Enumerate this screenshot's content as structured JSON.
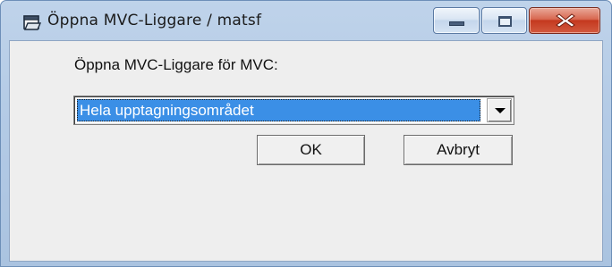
{
  "window": {
    "title": "Öppna MVC-Liggare / matsf",
    "icons": {
      "app": "folder-open-icon",
      "minimize": "minimize-icon",
      "maximize": "maximize-icon",
      "close": "close-icon"
    }
  },
  "dialog": {
    "prompt": "Öppna MVC-Liggare för MVC:",
    "selection": {
      "value": "Hela upptagningsområdet"
    },
    "buttons": {
      "ok": "OK",
      "cancel": "Avbryt"
    }
  },
  "colors": {
    "frame": "#b4cbe6",
    "close_button": "#c4391f",
    "selection_highlight": "#3b8fe6",
    "client_background": "#eeeeee"
  }
}
